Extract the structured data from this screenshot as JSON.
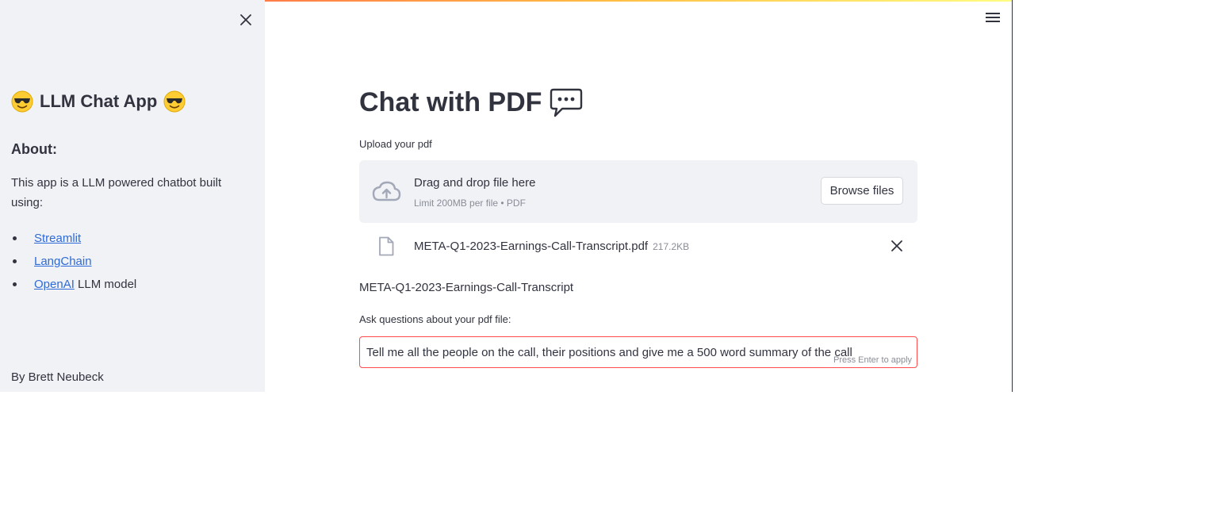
{
  "sidebar": {
    "title": "LLM Chat App",
    "title_emoji": "😎",
    "about_heading": "About:",
    "description": "This app is a LLM powered chatbot built using:",
    "links": [
      {
        "label": "Streamlit",
        "suffix": ""
      },
      {
        "label": "LangChain",
        "suffix": ""
      },
      {
        "label": "OpenAI",
        "suffix": " LLM model"
      }
    ],
    "author": "By Brett Neubeck",
    "close_icon": "close-icon"
  },
  "header": {
    "menu_icon": "hamburger-menu-icon",
    "accent_gradient": [
      "#ff4b4b",
      "#ffbd45",
      "#fffd80"
    ]
  },
  "main": {
    "title": "Chat with PDF",
    "title_icon": "speech-balloon-icon",
    "upload": {
      "label": "Upload your pdf",
      "drop_text": "Drag and drop file here",
      "limit_text": "Limit 200MB per file • PDF",
      "browse_label": "Browse files"
    },
    "file": {
      "name": "META-Q1-2023-Earnings-Call-Transcript.pdf",
      "size": "217.2KB"
    },
    "document_name": "META-Q1-2023-Earnings-Call-Transcript",
    "question": {
      "label": "Ask questions about your pdf file:",
      "value": "Tell me all the people on the call, their positions and give me a 500 word summary of the call",
      "hint": "Press Enter to apply"
    }
  },
  "colors": {
    "sidebar_bg": "#f0f2f6",
    "text": "#31333f",
    "link": "#2f6bd6",
    "error_border": "#ff4b4b",
    "muted": "#8a8d97"
  }
}
